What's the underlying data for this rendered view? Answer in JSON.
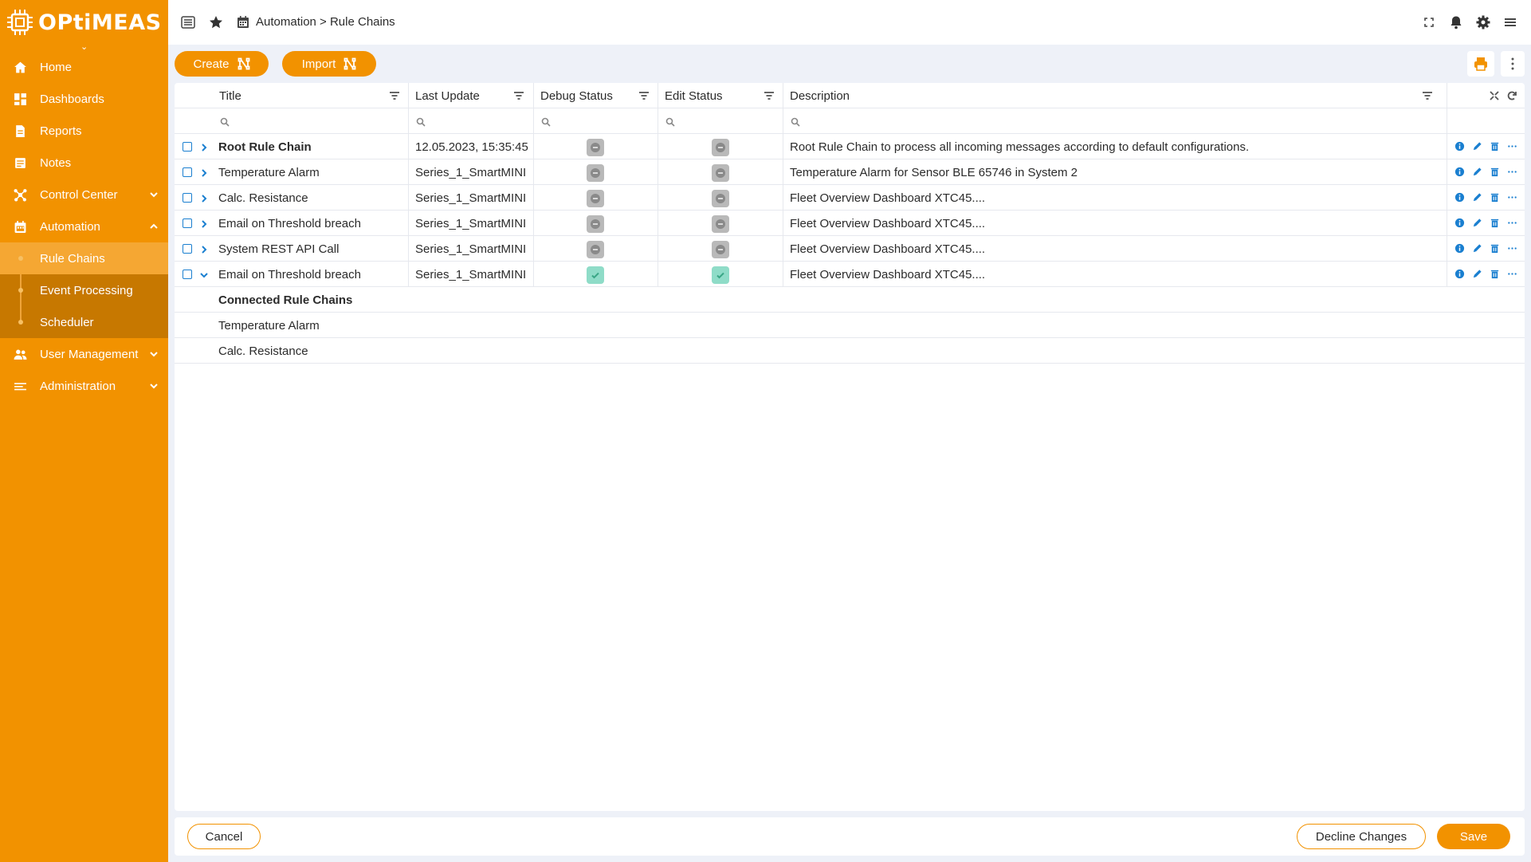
{
  "app": {
    "brand": "OPtiMEAS"
  },
  "colors": {
    "accent": "#f29200",
    "sidebar_dark": "#c77800",
    "link": "#1a7fd0",
    "status_on": "#8fdcc8",
    "status_off": "#b9b9b9"
  },
  "sidebar": {
    "items": [
      {
        "label": "Home",
        "icon": "home-icon"
      },
      {
        "label": "Dashboards",
        "icon": "dashboard-icon"
      },
      {
        "label": "Reports",
        "icon": "document-icon"
      },
      {
        "label": "Notes",
        "icon": "note-icon"
      },
      {
        "label": "Control Center",
        "icon": "network-icon"
      },
      {
        "label": "Automation",
        "icon": "calendar-icon"
      },
      {
        "label": "User Management",
        "icon": "users-icon"
      },
      {
        "label": "Administration",
        "icon": "list-icon"
      }
    ],
    "automation_sub": [
      {
        "label": "Rule Chains"
      },
      {
        "label": "Event Processing"
      },
      {
        "label": "Scheduler"
      }
    ]
  },
  "header": {
    "breadcrumb": "Automation > Rule Chains"
  },
  "toolbar": {
    "create_label": "Create",
    "import_label": "Import"
  },
  "table": {
    "columns": [
      "Title",
      "Last Update",
      "Debug Status",
      "Edit Status",
      "Description"
    ],
    "rows": [
      {
        "title": "Root Rule Chain",
        "last_update": "12.05.2023, 15:35:45",
        "debug": "off",
        "edit": "off",
        "description": "Root Rule Chain to process all incoming messages according to default  configurations.",
        "expanded": false
      },
      {
        "title": "Temperature Alarm",
        "last_update": "Series_1_SmartMINI",
        "debug": "off",
        "edit": "off",
        "description": "Temperature Alarm for Sensor BLE 65746 in System 2",
        "expanded": false
      },
      {
        "title": "Calc. Resistance",
        "last_update": "Series_1_SmartMINI",
        "debug": "off",
        "edit": "off",
        "description": "Fleet Overview Dashboard XTC45....",
        "expanded": false
      },
      {
        "title": "Email on Threshold breach",
        "last_update": "Series_1_SmartMINI",
        "debug": "off",
        "edit": "off",
        "description": "Fleet Overview Dashboard XTC45....",
        "expanded": false
      },
      {
        "title": "System REST API Call",
        "last_update": "Series_1_SmartMINI",
        "debug": "off",
        "edit": "off",
        "description": "Fleet Overview Dashboard XTC45....",
        "expanded": false
      },
      {
        "title": "Email on Threshold breach",
        "last_update": "Series_1_SmartMINI",
        "debug": "on",
        "edit": "on",
        "description": "Fleet Overview Dashboard XTC45....",
        "expanded": true
      }
    ],
    "connected": {
      "heading": "Connected Rule Chains",
      "items": [
        "Temperature Alarm",
        "Calc. Resistance"
      ]
    }
  },
  "footer": {
    "cancel_label": "Cancel",
    "decline_label": "Decline Changes",
    "save_label": "Save"
  }
}
